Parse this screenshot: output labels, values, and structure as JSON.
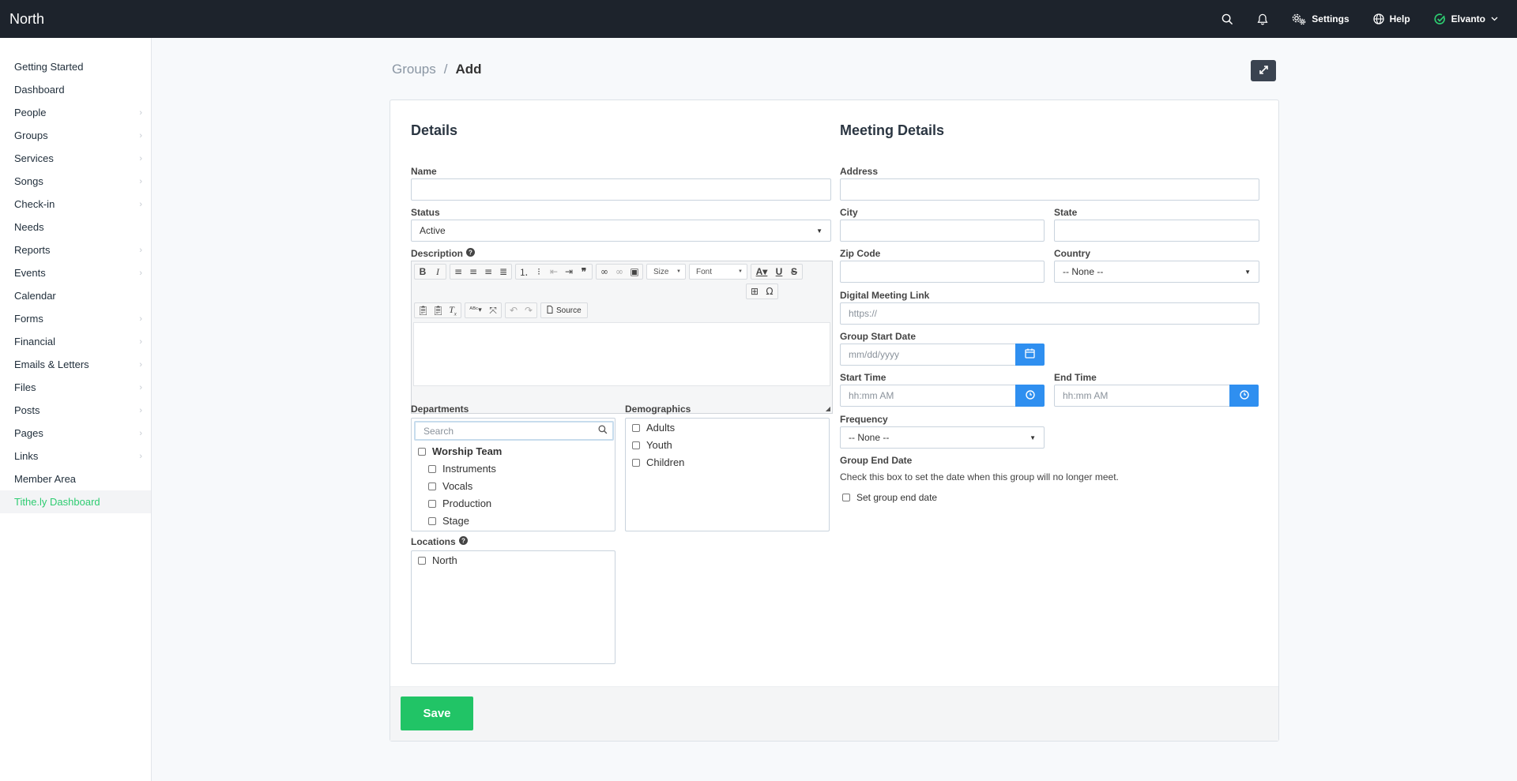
{
  "topbar": {
    "brand": "North",
    "settings_label": "Settings",
    "help_label": "Help",
    "user_label": "Elvanto",
    "icons": [
      "search-icon",
      "bell-icon",
      "gear-icon",
      "globe-icon",
      "check-circle-icon",
      "chevron-down-icon"
    ],
    "accent_color": "#2ecc71"
  },
  "sidebar": {
    "items": [
      {
        "label": "Getting Started"
      },
      {
        "label": "Dashboard"
      },
      {
        "label": "People"
      },
      {
        "label": "Groups"
      },
      {
        "label": "Services"
      },
      {
        "label": "Songs"
      },
      {
        "label": "Check-in"
      },
      {
        "label": "Needs"
      },
      {
        "label": "Reports"
      },
      {
        "label": "Events"
      },
      {
        "label": "Calendar"
      },
      {
        "label": "Forms"
      },
      {
        "label": "Financial"
      },
      {
        "label": "Emails & Letters"
      },
      {
        "label": "Files"
      },
      {
        "label": "Posts"
      },
      {
        "label": "Pages"
      },
      {
        "label": "Links"
      },
      {
        "label": "Member Area"
      },
      {
        "label": "Tithe.ly Dashboard"
      }
    ],
    "active_color": "#2ecc71"
  },
  "breadcrumb": {
    "parent": "Groups",
    "separator": "/",
    "current": "Add"
  },
  "details": {
    "heading": "Details",
    "name_label": "Name",
    "name_value": "",
    "status_label": "Status",
    "status_value": "Active",
    "description_label": "Description",
    "editor": {
      "size_label": "Size",
      "font_label": "Font",
      "source_label": "Source"
    },
    "departments_label": "Departments",
    "departments_search_placeholder": "Search",
    "departments": [
      {
        "label": "Worship Team",
        "checked": false
      },
      {
        "label": "Instruments",
        "checked": false
      },
      {
        "label": "Vocals",
        "checked": false
      },
      {
        "label": "Production",
        "checked": false
      },
      {
        "label": "Stage",
        "checked": false
      }
    ],
    "demographics_label": "Demographics",
    "demographics": [
      {
        "label": "Adults",
        "checked": false
      },
      {
        "label": "Youth",
        "checked": false
      },
      {
        "label": "Children",
        "checked": false
      }
    ],
    "locations_label": "Locations",
    "locations": [
      {
        "label": "North",
        "checked": false
      }
    ]
  },
  "meeting": {
    "heading": "Meeting Details",
    "address_label": "Address",
    "city_label": "City",
    "state_label": "State",
    "zip_label": "Zip Code",
    "country_label": "Country",
    "country_value": "-- None --",
    "link_label": "Digital Meeting Link",
    "link_placeholder": "https://",
    "start_date_label": "Group Start Date",
    "start_date_placeholder": "mm/dd/yyyy",
    "start_time_label": "Start Time",
    "start_time_placeholder": "hh:mm AM",
    "end_time_label": "End Time",
    "end_time_placeholder": "hh:mm AM",
    "frequency_label": "Frequency",
    "frequency_value": "-- None --",
    "end_date_label": "Group End Date",
    "end_date_help": "Check this box to set the date when this group will no longer meet.",
    "end_date_checkbox_label": "Set group end date",
    "addon_color": "#2f8ff0"
  },
  "footer": {
    "save_label": "Save",
    "save_color": "#21c466"
  }
}
